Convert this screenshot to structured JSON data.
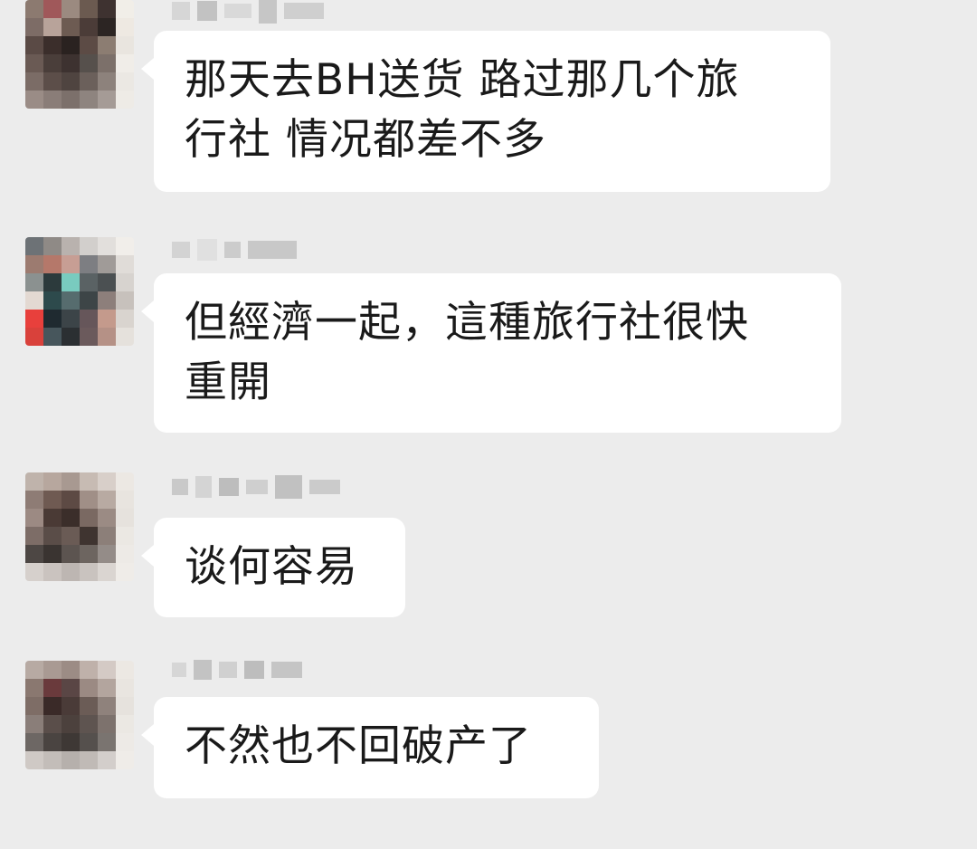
{
  "messages": [
    {
      "text": "那天去BH送货 路过那几个旅\n行社 情况都差不多",
      "avatar_colors": [
        "#8c7a70",
        "#a0585a",
        "#9b8a80",
        "#6b5a50",
        "#3e3230",
        "#f1eee8",
        "#7d6c66",
        "#b8a39a",
        "#6d5b52",
        "#4b3c38",
        "#2c2523",
        "#eee9e2",
        "#5a4a45",
        "#3b2e2b",
        "#2a2220",
        "#5c4b45",
        "#8c7d72",
        "#e9e5df",
        "#6a5a54",
        "#4a3e3a",
        "#3d3230",
        "#56504c",
        "#7c706a",
        "#f0ede8",
        "#7b6c66",
        "#5c4e49",
        "#4f4440",
        "#6b605b",
        "#8d827c",
        "#ebe8e3",
        "#9a8c86",
        "#8a7d78",
        "#7c706b",
        "#8e847f",
        "#a59b96",
        "#eeebe6"
      ]
    },
    {
      "text": "但經濟一起，這種旅行社很快\n重開",
      "avatar_colors": [
        "#6d7276",
        "#8f8a86",
        "#b9b2ae",
        "#d2cfcc",
        "#e2dfdc",
        "#f1eeea",
        "#9c7b70",
        "#b5786a",
        "#c79e94",
        "#7d7e82",
        "#a09b98",
        "#e0dcd8",
        "#8b9190",
        "#2c3a3c",
        "#79cbbf",
        "#5a6264",
        "#4b5052",
        "#d7d3cf",
        "#e3d9d2",
        "#2d4a4c",
        "#566c6e",
        "#3d4547",
        "#8d7f7b",
        "#c7c1bc",
        "#e8403c",
        "#1f2a30",
        "#3c4448",
        "#66565a",
        "#c49a8c",
        "#d9d4cf",
        "#d9413b",
        "#47565c",
        "#2b2f32",
        "#6b5a5c",
        "#b59186",
        "#e5e1dc"
      ]
    },
    {
      "text": "谈何容易",
      "avatar_colors": [
        "#bfb3ab",
        "#b7a79e",
        "#a89991",
        "#c7bbb3",
        "#d8cfc9",
        "#ece8e3",
        "#8e7c75",
        "#6f5a52",
        "#5d4a44",
        "#a08f87",
        "#b8aaa2",
        "#e8e4df",
        "#9c8a83",
        "#4a3a35",
        "#3b2e2a",
        "#7a6962",
        "#9b8b84",
        "#e6e2dd",
        "#7d6d67",
        "#5a4d48",
        "#6a5b55",
        "#3f3430",
        "#8c7f79",
        "#ebe8e3",
        "#4d4744",
        "#3a3431",
        "#5c5450",
        "#6d6560",
        "#948c88",
        "#edeae6",
        "#d6d0cc",
        "#cac3bf",
        "#bdb6b2",
        "#c9c3bf",
        "#dad5d1",
        "#efece8"
      ]
    },
    {
      "text": "不然也不回破产了",
      "avatar_colors": [
        "#b7aaa3",
        "#a99a93",
        "#9c8c85",
        "#bfb1aa",
        "#d4cac5",
        "#ece8e3",
        "#8a7870",
        "#6a3a3c",
        "#5a4645",
        "#9b8a83",
        "#b3a59e",
        "#e9e5e0",
        "#7e6d66",
        "#3a2a28",
        "#4a3b38",
        "#6b5c56",
        "#8f827c",
        "#e6e2dd",
        "#8a7e79",
        "#5a4e4a",
        "#4c413d",
        "#5e5450",
        "#7d726d",
        "#ebe8e3",
        "#6d6764",
        "#4a4441",
        "#3e3835",
        "#55504d",
        "#7a7470",
        "#edeae6",
        "#cfc9c5",
        "#c3bdb9",
        "#b6b0ac",
        "#c0bab6",
        "#d3cecb",
        "#efece8"
      ]
    }
  ]
}
